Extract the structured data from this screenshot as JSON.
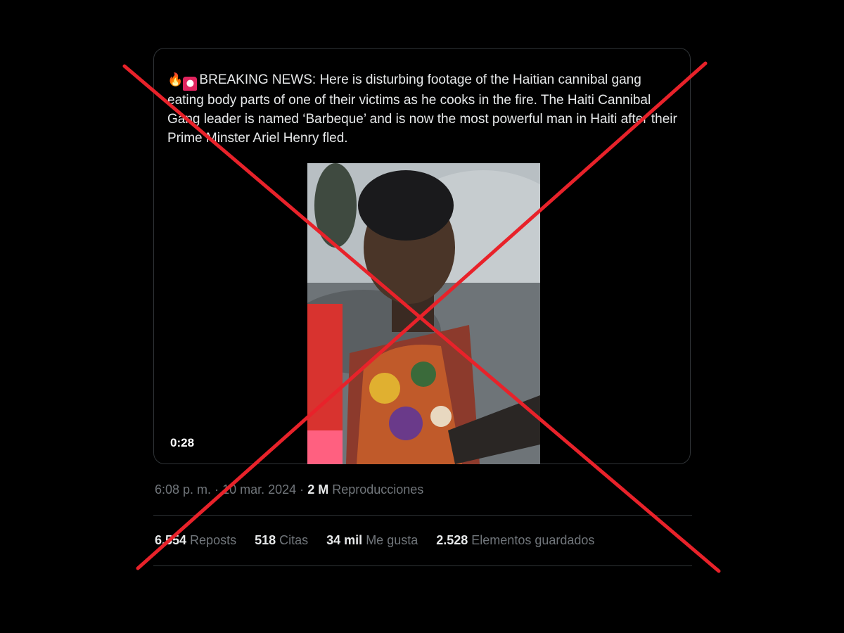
{
  "tweet": {
    "emoji_fire": "🔥",
    "emoji_siren": "🚨",
    "text": "BREAKING NEWS: Here is disturbing footage of the Haitian cannibal gang eating body parts of one of their victims as he cooks in the fire. The Haiti Cannibal Gang leader is named ‘Barbeque’ and is now the most powerful man in Haiti after their Prime Minster Ariel Henry fled.",
    "video": {
      "duration": "0:28"
    },
    "meta": {
      "time": "6:08 p. m.",
      "separator1": "·",
      "date": "10 mar. 2024",
      "separator2": "·",
      "views_count": "2 M",
      "views_label": "Reproducciones"
    },
    "stats": [
      {
        "num": "6.554",
        "label": "Reposts"
      },
      {
        "num": "518",
        "label": "Citas"
      },
      {
        "num": "34 mil",
        "label": "Me gusta"
      },
      {
        "num": "2.528",
        "label": "Elementos guardados"
      }
    ]
  },
  "overlay": {
    "cross_color": "#e8222a"
  }
}
